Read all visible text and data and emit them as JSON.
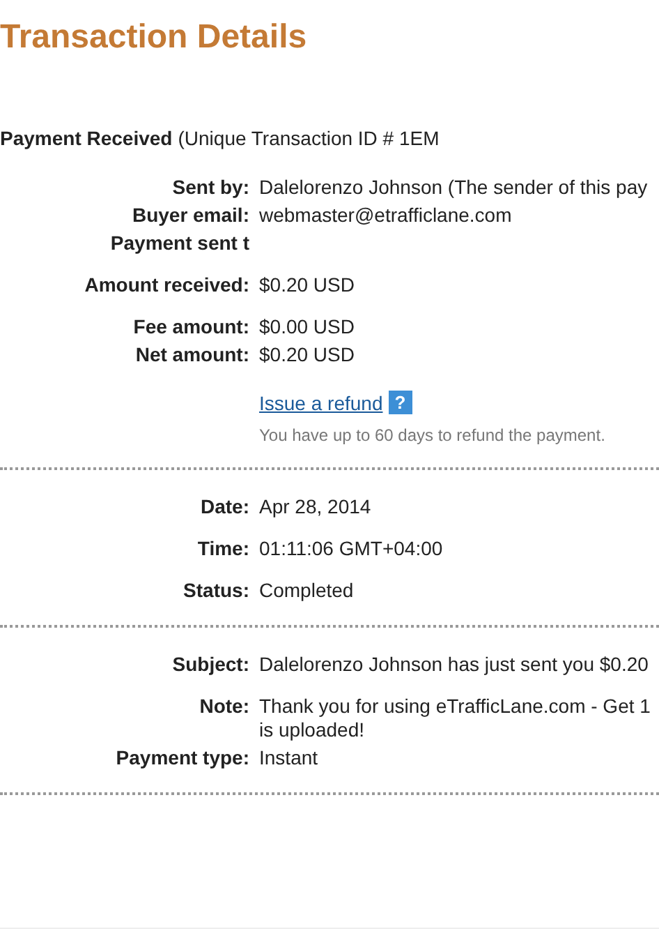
{
  "title": "Transaction Details",
  "heading": {
    "label": "Payment Received",
    "detail": "(Unique Transaction ID # 1EM"
  },
  "sections": [
    {
      "groups": [
        {
          "rows": [
            {
              "label": "Sent by:",
              "lines": [
                "Dalelorenzo Johnson (The sender of this pay"
              ]
            },
            {
              "label": "Buyer email:",
              "lines": [
                "webmaster@etrafficlane.com"
              ]
            },
            {
              "label": "Payment sent t",
              "lines": []
            }
          ]
        },
        {
          "rows": [
            {
              "label": "Amount received:",
              "lines": [
                "$0.20 USD"
              ]
            }
          ]
        },
        {
          "rows": [
            {
              "label": "Fee amount:",
              "lines": [
                "$0.00 USD"
              ]
            },
            {
              "label": "Net amount:",
              "lines": [
                "$0.20 USD"
              ]
            }
          ]
        }
      ],
      "refund": {
        "link": "Issue a refund",
        "help": "?",
        "note": "You have up to 60 days to refund the payment."
      }
    },
    {
      "groups": [
        {
          "rows": [
            {
              "label": "Date:",
              "lines": [
                "Apr 28, 2014"
              ]
            }
          ]
        },
        {
          "rows": [
            {
              "label": "Time:",
              "lines": [
                "01:11:06 GMT+04:00"
              ]
            }
          ]
        },
        {
          "rows": [
            {
              "label": "Status:",
              "lines": [
                "Completed"
              ]
            }
          ]
        }
      ]
    },
    {
      "groups": [
        {
          "rows": [
            {
              "label": "Subject:",
              "lines": [
                "Dalelorenzo Johnson has just sent you $0.20"
              ]
            }
          ]
        },
        {
          "rows": [
            {
              "label": "Note:",
              "lines": [
                "Thank you for using eTrafficLane.com - Get 1",
                "is uploaded!"
              ]
            },
            {
              "label": "Payment type:",
              "lines": [
                "Instant"
              ]
            }
          ]
        }
      ]
    }
  ]
}
